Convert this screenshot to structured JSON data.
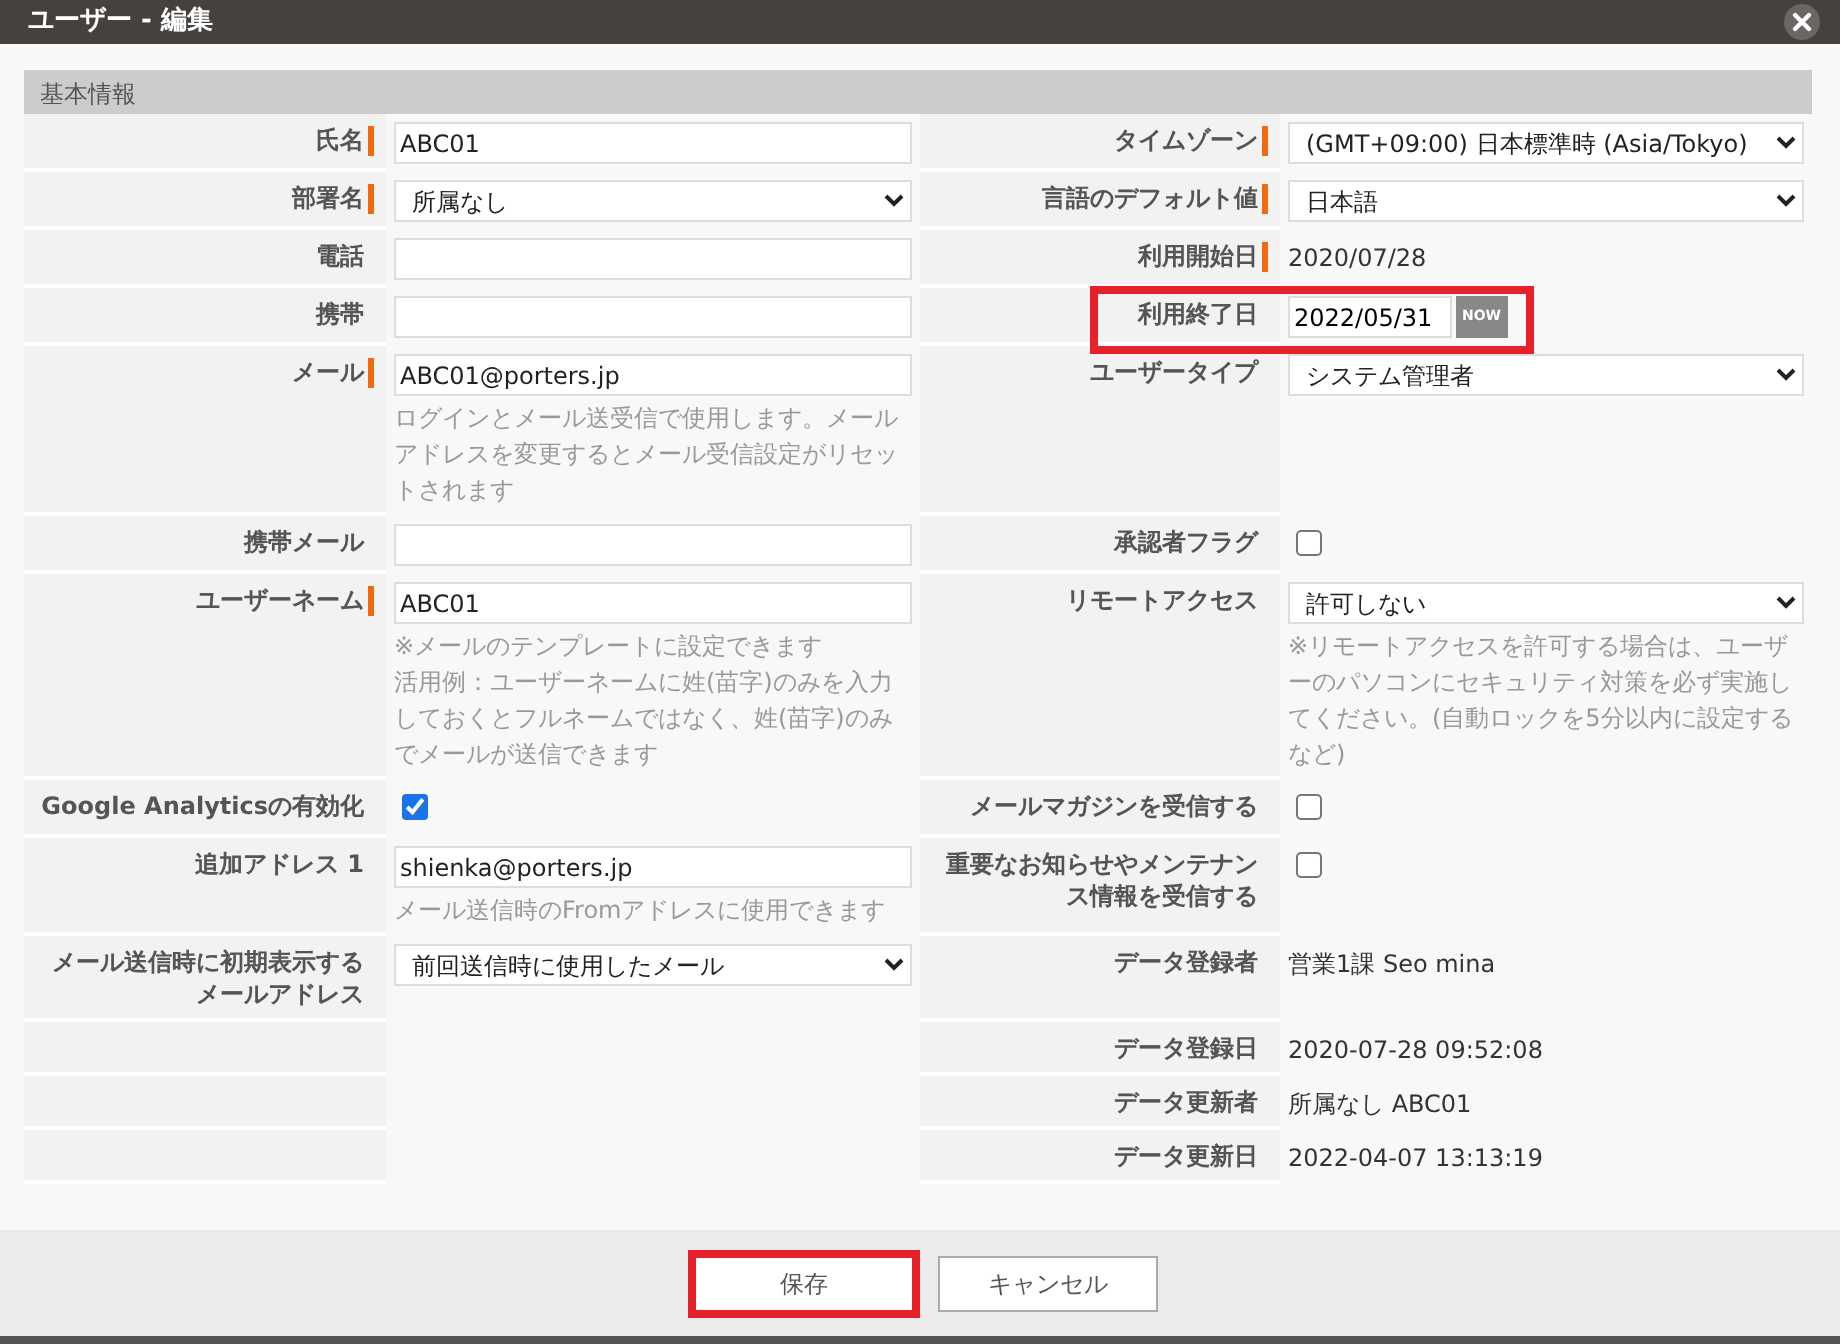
{
  "window": {
    "title": "ユーザー - 編集"
  },
  "section": {
    "title": "基本情報"
  },
  "rows": [
    {
      "left": {
        "label": "氏名",
        "required": true,
        "kind": "text",
        "value": "ABC01"
      },
      "right": {
        "label": "タイムゾーン",
        "required": true,
        "kind": "select",
        "value": "(GMT+09:00) 日本標準時 (Asia/Tokyo)"
      }
    },
    {
      "left": {
        "label": "部署名",
        "required": true,
        "kind": "select",
        "value": "所属なし"
      },
      "right": {
        "label": "言語のデフォルト値",
        "required": true,
        "kind": "select",
        "value": "日本語"
      }
    },
    {
      "left": {
        "label": "電話",
        "required": false,
        "kind": "text"
      },
      "right": {
        "label": "利用開始日",
        "required": true,
        "kind": "static",
        "value": "2020/07/28"
      }
    },
    {
      "left": {
        "label": "携帯",
        "required": false,
        "kind": "text"
      },
      "right": {
        "label": "利用終了日",
        "required": false,
        "kind": "date",
        "value": "2022/05/31",
        "button": "NOW",
        "highlighted": true
      }
    },
    {
      "left": {
        "label": "メール",
        "required": true,
        "kind": "text",
        "value": "ABC01@porters.jp",
        "hint": "ログインとメール送受信で使用します。メールアドレスを変更するとメール受信設定がリセットされます"
      },
      "right": {
        "label": "ユーザータイプ",
        "required": false,
        "kind": "select",
        "value": "システム管理者"
      }
    },
    {
      "left": {
        "label": "携帯メール",
        "required": false,
        "kind": "text"
      },
      "right": {
        "label": "承認者フラグ",
        "required": false,
        "kind": "checkbox",
        "checked": false
      }
    },
    {
      "left": {
        "label": "ユーザーネーム",
        "required": true,
        "kind": "text",
        "value": "ABC01",
        "hint": [
          "※メールのテンプレートに設定できます",
          "活用例：ユーザーネームに姓(苗字)のみを入力しておくとフルネームではなく、姓(苗字)のみでメールが送信できます"
        ]
      },
      "right": {
        "label": "リモートアクセス",
        "required": false,
        "kind": "select",
        "value": "許可しない",
        "hint": "※リモートアクセスを許可する場合は、ユーザーのパソコンにセキュリティ対策を必ず実施してください。(自動ロックを5分以内に設定するなど)"
      }
    },
    {
      "left": {
        "label": "Google Analyticsの有効化",
        "required": false,
        "kind": "checkbox",
        "checked": true
      },
      "right": {
        "label": "メールマガジンを受信する",
        "required": false,
        "kind": "checkbox",
        "checked": false
      }
    },
    {
      "left": {
        "label": "追加アドレス 1",
        "required": false,
        "kind": "text",
        "value": "shienka@porters.jp",
        "hint": "メール送信時のFromアドレスに使用できます"
      },
      "right": {
        "label": "重要なお知らせやメンテナンス情報を受信する",
        "required": false,
        "kind": "checkbox",
        "checked": false
      }
    },
    {
      "left": {
        "label": "メール送信時に初期表示するメールアドレス",
        "required": false,
        "kind": "select",
        "value": "前回送信時に使用したメール"
      },
      "right": {
        "label": "データ登録者",
        "required": false,
        "kind": "static",
        "value": "営業1課 Seo mina"
      }
    },
    {
      "right": {
        "label": "データ登録日",
        "required": false,
        "kind": "static",
        "value": "2020-07-28 09:52:08"
      }
    },
    {
      "right": {
        "label": "データ更新者",
        "required": false,
        "kind": "static",
        "value": "所属なし ABC01"
      }
    },
    {
      "right": {
        "label": "データ更新日",
        "required": false,
        "kind": "static",
        "value": "2022-04-07 13:13:19"
      }
    }
  ],
  "buttons": [
    {
      "label": "保存",
      "highlighted": true
    },
    {
      "label": "キャンセル",
      "highlighted": false
    }
  ]
}
